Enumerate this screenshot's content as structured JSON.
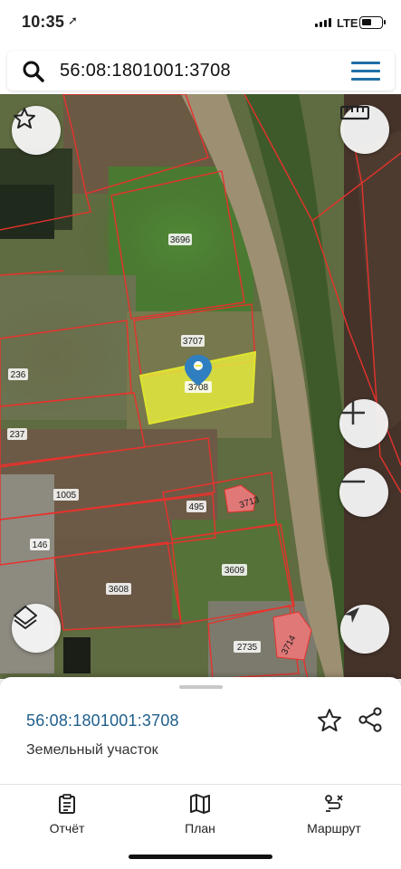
{
  "status_bar": {
    "time": "10:35",
    "network": "LTE",
    "battery_level": 0.5
  },
  "search": {
    "query": "56:08:1801001:3708"
  },
  "map": {
    "selected_parcel_label": "3708",
    "parcel_labels": [
      "3696",
      "3707",
      "236",
      "237",
      "1005",
      "495",
      "3713",
      "146",
      "3608",
      "3609",
      "2735",
      "3714"
    ],
    "colors": {
      "boundary": "#e8322c",
      "selected_fill": "#e9ee3c",
      "marker": "#2f7fc0"
    }
  },
  "details": {
    "cadastral_number": "56:08:1801001:3708",
    "object_type": "Земельный участок"
  },
  "tabs": [
    {
      "label": "Отчёт",
      "icon": "report-icon"
    },
    {
      "label": "План",
      "icon": "map-plan-icon"
    },
    {
      "label": "Маршрут",
      "icon": "route-icon"
    }
  ]
}
